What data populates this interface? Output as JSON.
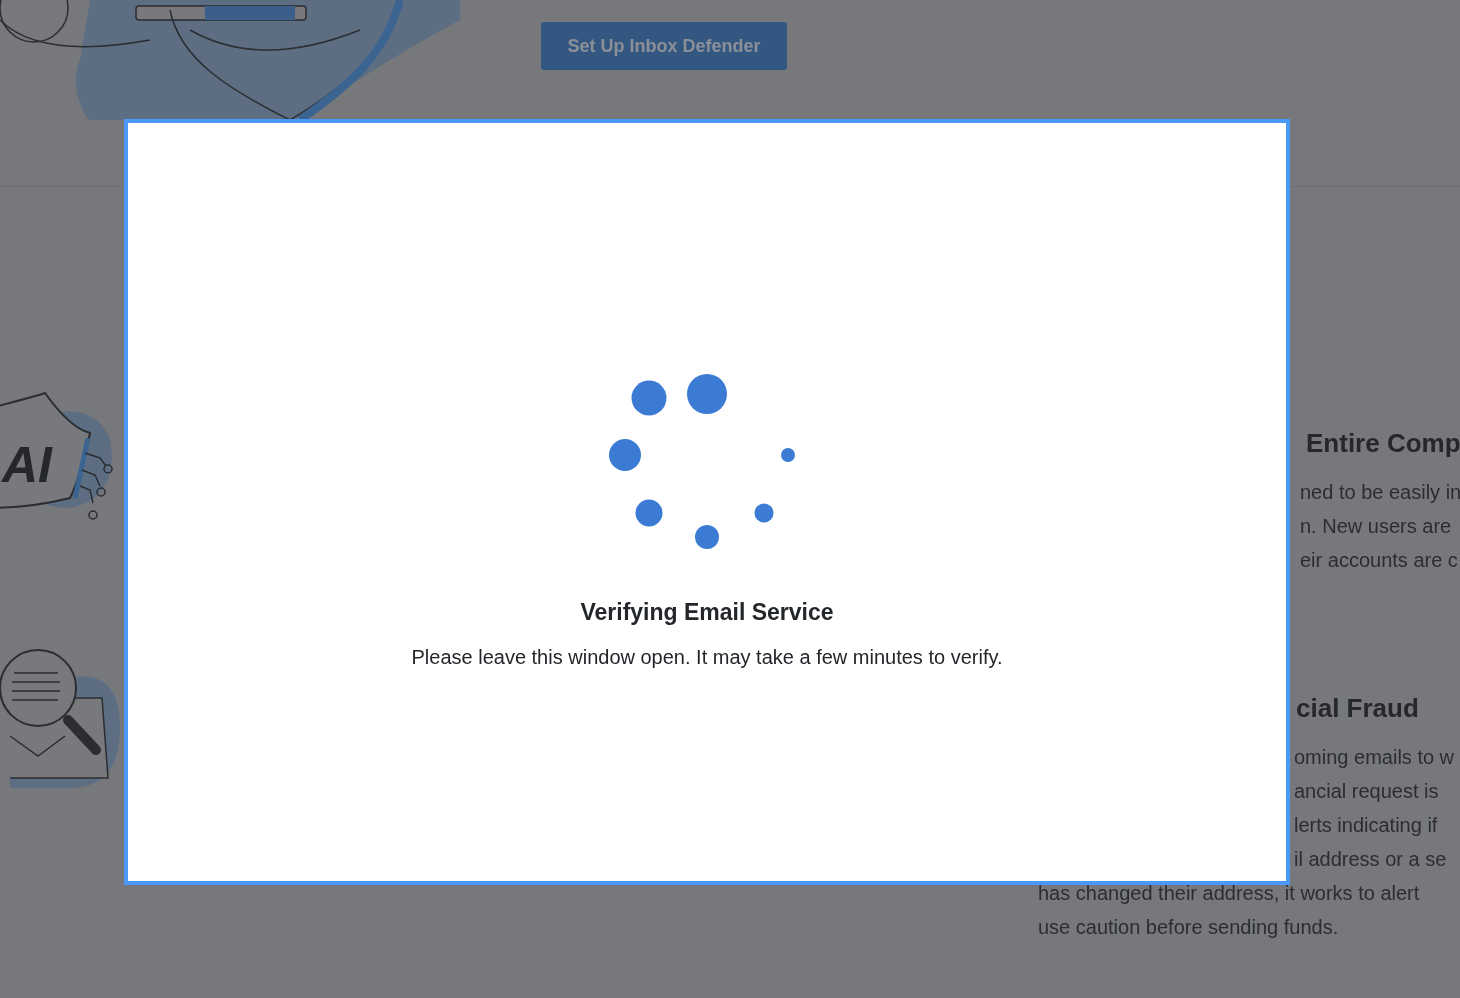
{
  "hero": {
    "button": "Set Up Inbox Defender"
  },
  "features": [
    {
      "badge": "AI",
      "title": "Entire Comp",
      "lines": [
        "ned to be easily in",
        "n. New users are",
        "eir accounts are c"
      ]
    },
    {
      "title": "cial Fraud",
      "lines": [
        "oming emails to w",
        "ancial request is",
        "lerts indicating if",
        "il address or a se"
      ],
      "tail_lines": [
        "has changed their address, it works to alert",
        "use caution before sending funds."
      ]
    }
  ],
  "modal": {
    "title": "Verifying Email Service",
    "message": "Please leave this window open. It may take a few minutes to verify."
  }
}
